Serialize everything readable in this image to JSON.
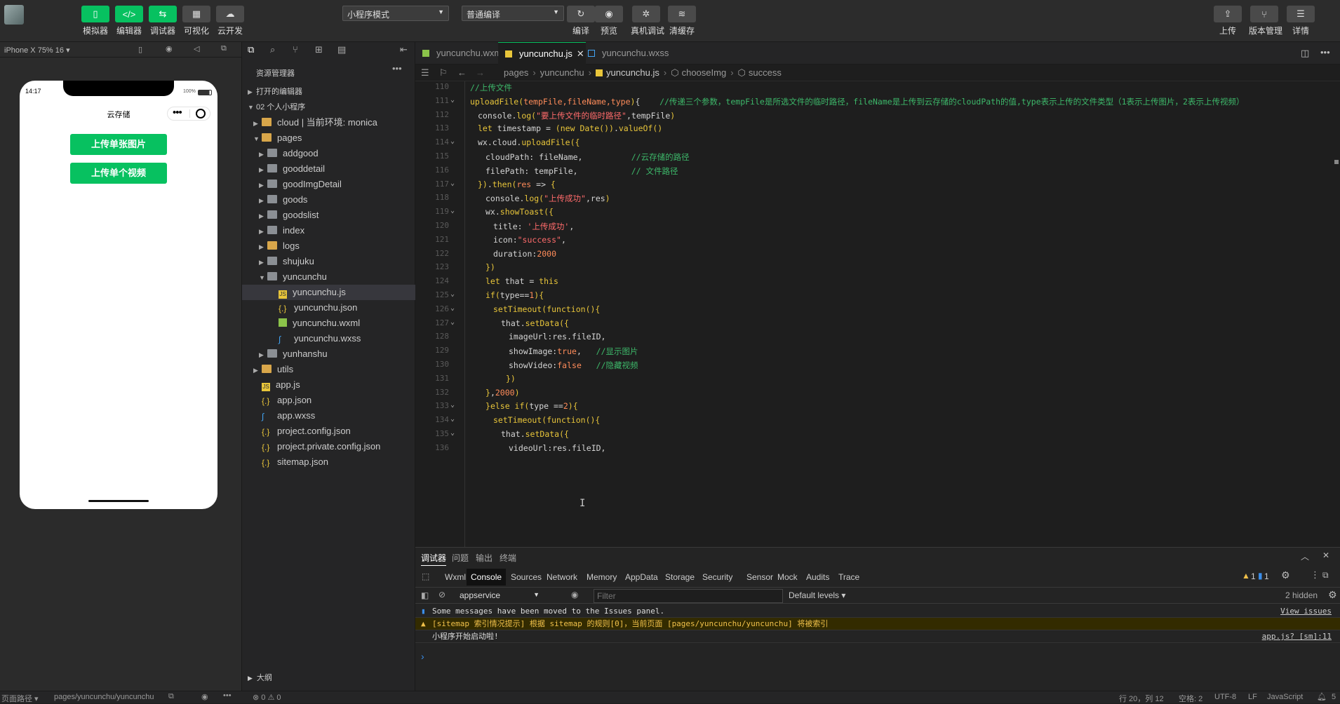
{
  "toolbar": {
    "left_buttons": [
      {
        "label": "模拟器",
        "icon": "phone-icon",
        "glyph": "▯"
      },
      {
        "label": "编辑器",
        "icon": "code-icon",
        "glyph": "</>"
      },
      {
        "label": "调试器",
        "icon": "debug-icon",
        "glyph": "⇆"
      },
      {
        "label": "可视化",
        "icon": "layout-icon",
        "glyph": "▦"
      },
      {
        "label": "云开发",
        "icon": "cloud-icon",
        "glyph": "☁"
      }
    ],
    "mode_select": "小程序模式",
    "compile_select": "普通编译",
    "mid_buttons": [
      {
        "label": "编译",
        "icon": "refresh-icon",
        "glyph": "↻"
      },
      {
        "label": "预览",
        "icon": "eye-icon",
        "glyph": "◉"
      },
      {
        "label": "真机调试",
        "icon": "bug-icon",
        "glyph": "✲"
      },
      {
        "label": "清缓存",
        "icon": "layers-icon",
        "glyph": "≋"
      }
    ],
    "right_buttons": [
      {
        "label": "上传",
        "icon": "upload-icon",
        "glyph": "⇪"
      },
      {
        "label": "版本管理",
        "icon": "branch-icon",
        "glyph": "⑂"
      },
      {
        "label": "详情",
        "icon": "menu-icon",
        "glyph": "☰"
      }
    ]
  },
  "simulator": {
    "device": "iPhone X 75% 16 ▾",
    "time": "14:17",
    "battery": "100%",
    "page_title": "云存储",
    "buttons": [
      "上传单张图片",
      "上传单个视频"
    ],
    "path_label": "页面路径 ▾",
    "path": "pages/yuncunchu/yuncunchu"
  },
  "explorer": {
    "title": "资源管理器",
    "sections": [
      "打开的编辑器",
      "02 个人小程序"
    ],
    "items": [
      {
        "label": "cloud | 当前环境: monica",
        "depth": 1,
        "arrow": "▶",
        "type": "folder-ext"
      },
      {
        "label": "pages",
        "depth": 1,
        "arrow": "▼",
        "type": "folder-ext"
      },
      {
        "label": "addgood",
        "depth": 2,
        "arrow": "▶",
        "type": "folder"
      },
      {
        "label": "gooddetail",
        "depth": 2,
        "arrow": "▶",
        "type": "folder"
      },
      {
        "label": "goodImgDetail",
        "depth": 2,
        "arrow": "▶",
        "type": "folder"
      },
      {
        "label": "goods",
        "depth": 2,
        "arrow": "▶",
        "type": "folder"
      },
      {
        "label": "goodslist",
        "depth": 2,
        "arrow": "▶",
        "type": "folder"
      },
      {
        "label": "index",
        "depth": 2,
        "arrow": "▶",
        "type": "folder"
      },
      {
        "label": "logs",
        "depth": 2,
        "arrow": "▶",
        "type": "folder-ext"
      },
      {
        "label": "shujuku",
        "depth": 2,
        "arrow": "▶",
        "type": "folder"
      },
      {
        "label": "yuncunchu",
        "depth": 2,
        "arrow": "▼",
        "type": "folder"
      },
      {
        "label": "yuncunchu.js",
        "depth": 3,
        "arrow": "",
        "type": "js",
        "selected": true
      },
      {
        "label": "yuncunchu.json",
        "depth": 3,
        "arrow": "",
        "type": "json"
      },
      {
        "label": "yuncunchu.wxml",
        "depth": 3,
        "arrow": "",
        "type": "wxml"
      },
      {
        "label": "yuncunchu.wxss",
        "depth": 3,
        "arrow": "",
        "type": "wxss"
      },
      {
        "label": "yunhanshu",
        "depth": 2,
        "arrow": "▶",
        "type": "folder"
      },
      {
        "label": "utils",
        "depth": 1,
        "arrow": "▶",
        "type": "folder-ext"
      },
      {
        "label": "app.js",
        "depth": 1,
        "arrow": "",
        "type": "js"
      },
      {
        "label": "app.json",
        "depth": 1,
        "arrow": "",
        "type": "json"
      },
      {
        "label": "app.wxss",
        "depth": 1,
        "arrow": "",
        "type": "wxss"
      },
      {
        "label": "project.config.json",
        "depth": 1,
        "arrow": "",
        "type": "json"
      },
      {
        "label": "project.private.config.json",
        "depth": 1,
        "arrow": "",
        "type": "json"
      },
      {
        "label": "sitemap.json",
        "depth": 1,
        "arrow": "",
        "type": "json"
      }
    ],
    "outline": "大纲",
    "status": "⊗ 0 ⚠ 0"
  },
  "editor": {
    "tabs": [
      {
        "label": "yuncunchu.wxml",
        "active": false
      },
      {
        "label": "yuncunchu.js",
        "active": true
      },
      {
        "label": "yuncunchu.wxss",
        "active": false
      }
    ],
    "breadcrumb": [
      "pages",
      "yuncunchu",
      "yuncunchu.js",
      "chooseImg",
      "success"
    ],
    "lines": [
      {
        "n": "110",
        "indent": 0,
        "fold": false,
        "parts": [
          [
            "c",
            "//上传文件"
          ]
        ]
      },
      {
        "n": "111",
        "indent": 0,
        "fold": true,
        "parts": [
          [
            "f",
            "uploadFile"
          ],
          [
            "p",
            "("
          ],
          [
            "n",
            "tempFile,fileName,type"
          ],
          [
            "p",
            ")"
          ],
          [
            "v",
            "{    "
          ],
          [
            "c",
            "//传递三个参数，tempFile是所选文件的临时路径，fileName是上传到云存储的cloudPath的值,type表示上传的文件类型（1表示上传图片，2表示上传视频）"
          ]
        ]
      },
      {
        "n": "112",
        "indent": 1,
        "fold": false,
        "parts": [
          [
            "v",
            "console."
          ],
          [
            "f",
            "log"
          ],
          [
            "p",
            "("
          ],
          [
            "s",
            "\"要上传文件的临时路径\""
          ],
          [
            "v",
            ",tempFile"
          ],
          [
            "p",
            ")"
          ]
        ]
      },
      {
        "n": "113",
        "indent": 1,
        "fold": false,
        "parts": [
          [
            "k",
            "let"
          ],
          [
            "v",
            " timestamp = "
          ],
          [
            "p",
            "("
          ],
          [
            "k",
            "new"
          ],
          [
            "v",
            " "
          ],
          [
            "f",
            "Date"
          ],
          [
            "p",
            "())"
          ],
          [
            "v",
            "."
          ],
          [
            "f",
            "valueOf"
          ],
          [
            "p",
            "()"
          ]
        ]
      },
      {
        "n": "114",
        "indent": 1,
        "fold": true,
        "parts": [
          [
            "v",
            "wx.cloud."
          ],
          [
            "f",
            "uploadFile"
          ],
          [
            "p",
            "({"
          ]
        ]
      },
      {
        "n": "115",
        "indent": 2,
        "fold": false,
        "parts": [
          [
            "v",
            "cloudPath: fileName,          "
          ],
          [
            "c",
            "//云存储的路径"
          ]
        ]
      },
      {
        "n": "116",
        "indent": 2,
        "fold": false,
        "parts": [
          [
            "v",
            "filePath: tempFile,           "
          ],
          [
            "c",
            "// 文件路径"
          ]
        ]
      },
      {
        "n": "117",
        "indent": 1,
        "fold": true,
        "parts": [
          [
            "p",
            "})"
          ],
          [
            "v",
            "."
          ],
          [
            "f",
            "then"
          ],
          [
            "p",
            "("
          ],
          [
            "n",
            "res"
          ],
          [
            "v",
            " => "
          ],
          [
            "p",
            "{"
          ]
        ]
      },
      {
        "n": "118",
        "indent": 2,
        "fold": false,
        "parts": [
          [
            "v",
            "console."
          ],
          [
            "f",
            "log"
          ],
          [
            "p",
            "("
          ],
          [
            "s",
            "\"上传成功\""
          ],
          [
            "v",
            ",res"
          ],
          [
            "p",
            ")"
          ]
        ]
      },
      {
        "n": "119",
        "indent": 2,
        "fold": true,
        "parts": [
          [
            "v",
            "wx."
          ],
          [
            "f",
            "showToast"
          ],
          [
            "p",
            "({"
          ]
        ]
      },
      {
        "n": "120",
        "indent": 3,
        "fold": false,
        "parts": [
          [
            "v",
            "title: "
          ],
          [
            "s",
            "'上传成功'"
          ],
          [
            "v",
            ","
          ]
        ]
      },
      {
        "n": "121",
        "indent": 3,
        "fold": false,
        "parts": [
          [
            "v",
            "icon:"
          ],
          [
            "s",
            "\"success\""
          ],
          [
            "v",
            ","
          ]
        ]
      },
      {
        "n": "122",
        "indent": 3,
        "fold": false,
        "parts": [
          [
            "v",
            "duration:"
          ],
          [
            "n",
            "2000"
          ]
        ]
      },
      {
        "n": "123",
        "indent": 2,
        "fold": false,
        "parts": [
          [
            "p",
            "})"
          ]
        ]
      },
      {
        "n": "124",
        "indent": 2,
        "fold": false,
        "parts": [
          [
            "k",
            "let"
          ],
          [
            "v",
            " that = "
          ],
          [
            "k",
            "this"
          ]
        ]
      },
      {
        "n": "125",
        "indent": 2,
        "fold": true,
        "parts": [
          [
            "k",
            "if"
          ],
          [
            "p",
            "("
          ],
          [
            "v",
            "type=="
          ],
          [
            "n",
            "1"
          ],
          [
            "p",
            ")"
          ],
          [
            "p",
            "{"
          ]
        ]
      },
      {
        "n": "126",
        "indent": 3,
        "fold": true,
        "parts": [
          [
            "f",
            "setTimeout"
          ],
          [
            "p",
            "("
          ],
          [
            "k",
            "function"
          ],
          [
            "p",
            "(){"
          ]
        ]
      },
      {
        "n": "127",
        "indent": 4,
        "fold": true,
        "parts": [
          [
            "v",
            "that."
          ],
          [
            "f",
            "setData"
          ],
          [
            "p",
            "({"
          ]
        ]
      },
      {
        "n": "128",
        "indent": 5,
        "fold": false,
        "parts": [
          [
            "v",
            "imageUrl:res.fileID,"
          ]
        ]
      },
      {
        "n": "129",
        "indent": 5,
        "fold": false,
        "parts": [
          [
            "v",
            "showImage:"
          ],
          [
            "n",
            "true"
          ],
          [
            "v",
            ",   "
          ],
          [
            "c",
            "//显示图片"
          ]
        ]
      },
      {
        "n": "130",
        "indent": 5,
        "fold": false,
        "parts": [
          [
            "v",
            "showVideo:"
          ],
          [
            "n",
            "false"
          ],
          [
            "v",
            "   "
          ],
          [
            "c",
            "//隐藏视频"
          ]
        ]
      },
      {
        "n": "131",
        "indent": 4,
        "fold": false,
        "parts": [
          [
            "v",
            " "
          ],
          [
            "p",
            "})"
          ]
        ]
      },
      {
        "n": "132",
        "indent": 2,
        "fold": false,
        "parts": [
          [
            "p",
            "}"
          ],
          [
            "v",
            ","
          ],
          [
            "n",
            "2000"
          ],
          [
            "p",
            ")"
          ]
        ]
      },
      {
        "n": "133",
        "indent": 2,
        "fold": true,
        "parts": [
          [
            "p",
            "}"
          ],
          [
            "k",
            "else if"
          ],
          [
            "p",
            "("
          ],
          [
            "v",
            "type =="
          ],
          [
            "n",
            "2"
          ],
          [
            "p",
            ")"
          ],
          [
            "p",
            "{"
          ]
        ]
      },
      {
        "n": "134",
        "indent": 3,
        "fold": true,
        "parts": [
          [
            "f",
            "setTimeout"
          ],
          [
            "p",
            "("
          ],
          [
            "k",
            "function"
          ],
          [
            "p",
            "(){"
          ]
        ]
      },
      {
        "n": "135",
        "indent": 4,
        "fold": true,
        "parts": [
          [
            "v",
            "that."
          ],
          [
            "f",
            "setData"
          ],
          [
            "p",
            "({"
          ]
        ]
      },
      {
        "n": "136",
        "indent": 5,
        "fold": false,
        "parts": [
          [
            "v",
            "videoUrl:res.fileID,"
          ]
        ]
      }
    ],
    "cursor": "行 20，列 12",
    "spaces": "空格: 2",
    "encoding": "UTF-8",
    "eol": "LF",
    "language": "JavaScript",
    "notifications": "5"
  },
  "console": {
    "panel_tabs": [
      "调试器",
      "问题",
      "输出",
      "终端"
    ],
    "devtools_tabs": [
      "Wxml",
      "Console",
      "Sources",
      "Network",
      "Memory",
      "AppData",
      "Storage",
      "Security",
      "Sensor",
      "Mock",
      "Audits",
      "Trace"
    ],
    "warn_count": "1",
    "info_count": "1",
    "context": "appservice",
    "filter_placeholder": "Filter",
    "levels": "Default levels ▾",
    "hidden": "2 hidden",
    "messages": [
      {
        "type": "info",
        "text": "Some messages have been moved to the Issues panel.",
        "link": "View issues"
      },
      {
        "type": "warn",
        "text": "[sitemap 索引情况提示] 根据 sitemap 的规则[0]，当前页面 [pages/yuncunchu/yuncunchu] 将被索引",
        "link": ""
      },
      {
        "type": "log",
        "text": "小程序开始启动啦!",
        "link": "app.js? [sm]:11"
      }
    ],
    "prompt": "›"
  },
  "colors": {
    "accent": "#07c160",
    "warn_bg": "#332b00",
    "warn_text": "#f0c04a"
  }
}
